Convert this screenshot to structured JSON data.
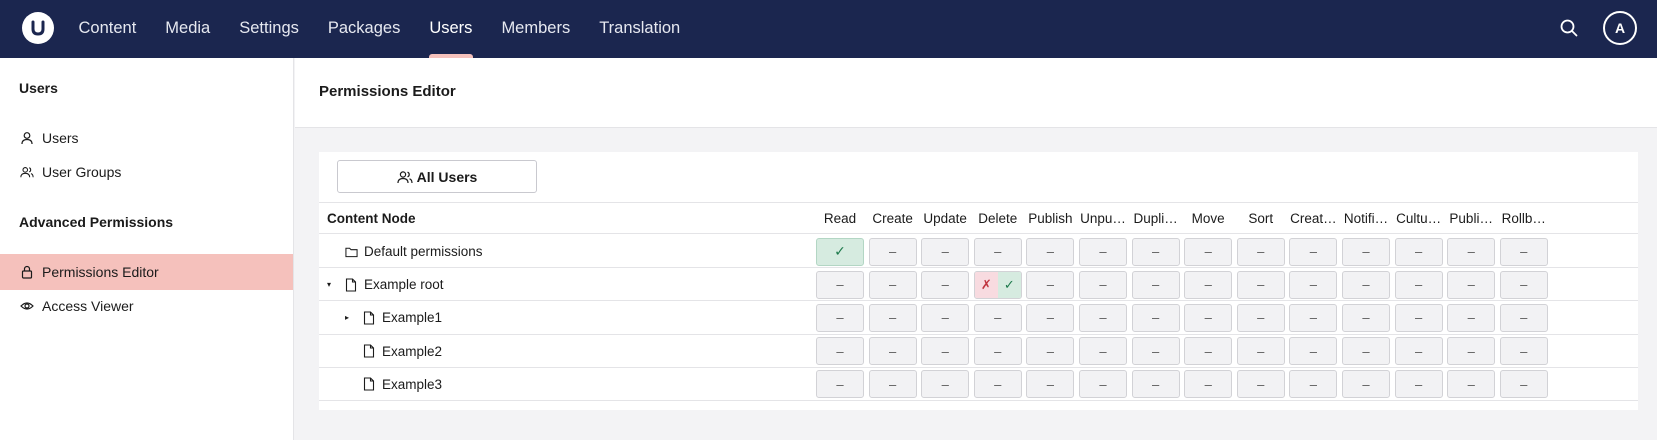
{
  "nav": {
    "items": [
      "Content",
      "Media",
      "Settings",
      "Packages",
      "Users",
      "Members",
      "Translation"
    ],
    "active_index": 4
  },
  "user": {
    "initial": "A"
  },
  "sidebar": {
    "section_users": "Users",
    "item_users": "Users",
    "item_user_groups": "User Groups",
    "section_advanced": "Advanced Permissions",
    "item_permissions_editor": "Permissions Editor",
    "item_access_viewer": "Access Viewer",
    "active": "Permissions Editor"
  },
  "main": {
    "title": "Permissions Editor",
    "all_users_label": "All Users",
    "table": {
      "node_header": "Content Node",
      "permission_headers": [
        "Read",
        "Create",
        "Update",
        "Delete",
        "Publish",
        "Unpu…",
        "Dupli…",
        "Move",
        "Sort",
        "Creat…",
        "Notifi…",
        "Cultu…",
        "Publi…",
        "Rollb…"
      ],
      "rows": [
        {
          "name": "Default permissions",
          "icon": "folder-icon",
          "expander": "",
          "cells": [
            "allow",
            "none",
            "none",
            "none",
            "none",
            "none",
            "none",
            "none",
            "none",
            "none",
            "none",
            "none",
            "none",
            "none"
          ]
        },
        {
          "name": "Example root",
          "icon": "document-icon",
          "expander": "▾",
          "cells": [
            "none",
            "none",
            "none",
            "deny-allow",
            "none",
            "none",
            "none",
            "none",
            "none",
            "none",
            "none",
            "none",
            "none",
            "none"
          ]
        },
        {
          "name": "Example1",
          "icon": "document-icon",
          "expander": "▸",
          "cells": [
            "none",
            "none",
            "none",
            "none",
            "none",
            "none",
            "none",
            "none",
            "none",
            "none",
            "none",
            "none",
            "none",
            "none"
          ]
        },
        {
          "name": "Example2",
          "icon": "document-icon",
          "expander": "",
          "cells": [
            "none",
            "none",
            "none",
            "none",
            "none",
            "none",
            "none",
            "none",
            "none",
            "none",
            "none",
            "none",
            "none",
            "none"
          ]
        },
        {
          "name": "Example3",
          "icon": "document-icon",
          "expander": "",
          "cells": [
            "none",
            "none",
            "none",
            "none",
            "none",
            "none",
            "none",
            "none",
            "none",
            "none",
            "none",
            "none",
            "none",
            "none"
          ]
        }
      ],
      "symbols": {
        "none": "–",
        "allow": "✓",
        "deny": "✗"
      }
    }
  },
  "colors": {
    "topbar": "#1b264f",
    "active_accent": "#f5c1bc",
    "allow": "#d6ebe0",
    "deny": "#f8dbe0"
  }
}
